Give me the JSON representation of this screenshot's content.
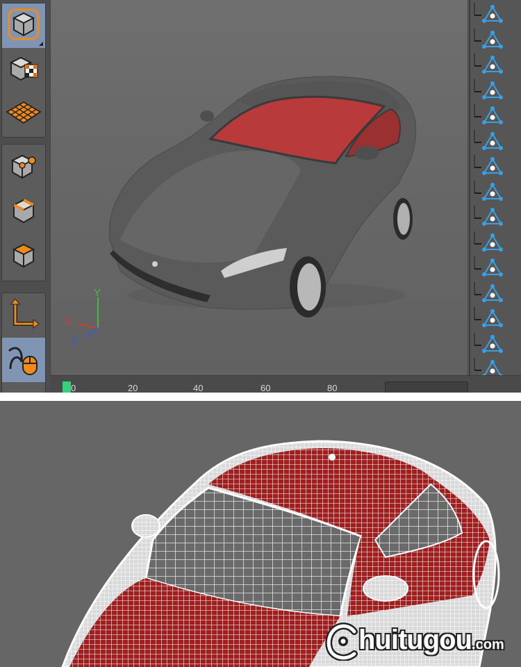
{
  "app": {
    "toolbar": {
      "groups": [
        {
          "tools": [
            "model-mode-icon",
            "texture-mode-icon",
            "workplane-mode-icon"
          ]
        },
        {
          "tools": [
            "points-mode-icon",
            "edges-mode-icon",
            "polygons-mode-icon"
          ]
        },
        {
          "tools": [
            "axis-mode-icon",
            "tweak-mode-icon"
          ]
        }
      ],
      "active_tool": "model-mode-icon"
    },
    "viewport": {
      "axis_labels": {
        "y": "Y",
        "x": "X",
        "z": "Z"
      },
      "colors": {
        "axis_y": "#3fbf3f",
        "axis_x": "#d23a3a",
        "axis_z": "#3a5ad2",
        "car_body": "#5a5a5a",
        "car_interior": "#b83a3a"
      }
    },
    "timeline": {
      "ticks": [
        "0",
        "20",
        "40",
        "60",
        "80"
      ],
      "current_frame": 0
    },
    "object_manager": {
      "row_count": 15,
      "row_icon": "null-object-icon",
      "icon_color": "#3aa0e6"
    }
  },
  "render": {
    "style": "wireframe",
    "colors": {
      "background": "#666666",
      "wire": "#ffffff",
      "fill": "#a51c1c"
    },
    "watermark": {
      "text": "huitugou",
      "suffix": ".com",
      "logo": "c-swirl-logo"
    }
  }
}
